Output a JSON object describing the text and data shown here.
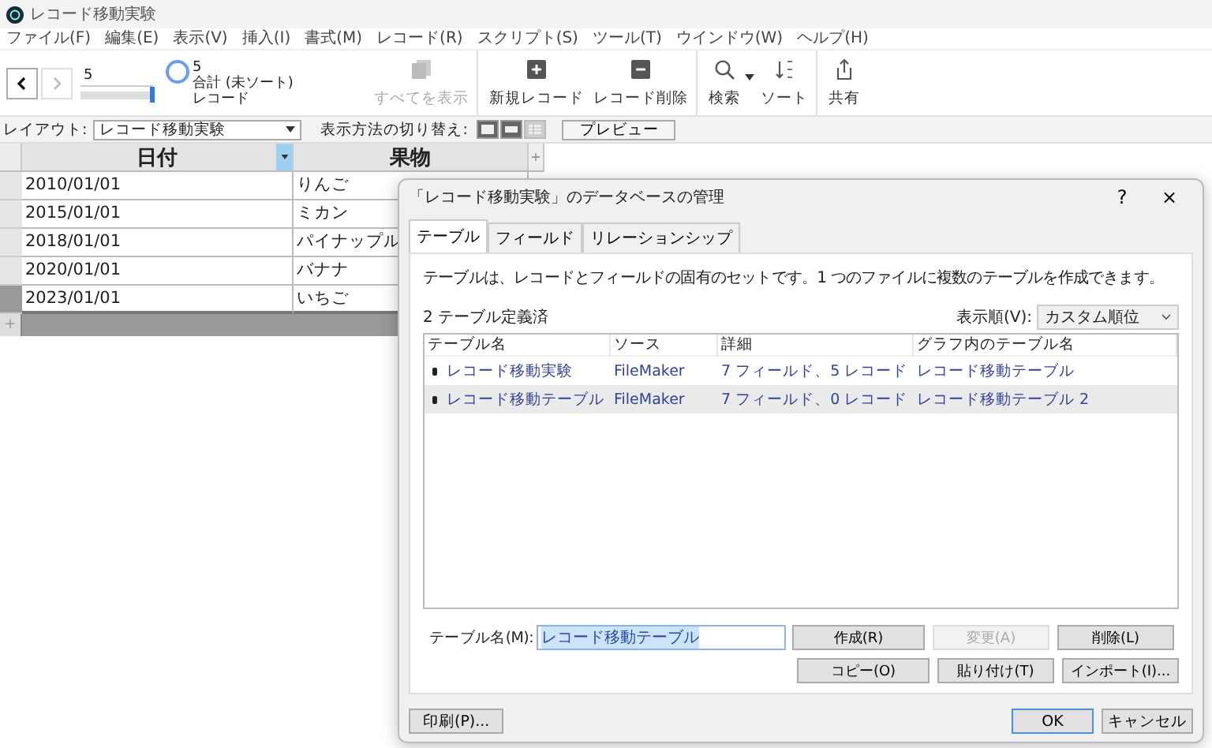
{
  "window": {
    "title": "レコード移動実験"
  },
  "menu": [
    "ファイル(F)",
    "編集(E)",
    "表示(V)",
    "挿入(I)",
    "書式(M)",
    "レコード(R)",
    "スクリプト(S)",
    "ツール(T)",
    "ウインドウ(W)",
    "ヘルプ(H)"
  ],
  "toolbar": {
    "record_field": "5",
    "record_slider": {
      "level": 1
    },
    "record_count": "5",
    "record_status": "合計 (未ソート)",
    "record_unit": "レコード",
    "groups": [
      [
        {
          "kind": "show-all",
          "label": "すべてを表示",
          "disabled": true
        }
      ],
      [
        {
          "kind": "new",
          "label": "新規レコード",
          "disabled": false
        },
        {
          "kind": "delete",
          "label": "レコード削除",
          "disabled": false
        }
      ],
      [
        {
          "kind": "search",
          "label": "検索",
          "disabled": false
        },
        {
          "kind": "sort",
          "label": "ソート",
          "disabled": false
        }
      ],
      [
        {
          "kind": "share",
          "label": "共有",
          "disabled": false
        }
      ]
    ]
  },
  "layout_bar": {
    "layout_label": "レイアウト:",
    "layout_value": "レコード移動実験",
    "view_label": "表示方法の切り替え:",
    "view_modes": [
      {
        "kind": "form",
        "selected": false
      },
      {
        "kind": "list",
        "selected": false
      },
      {
        "kind": "table",
        "selected": true
      }
    ],
    "preview_button": "プレビュー"
  },
  "table": {
    "columns": [
      {
        "label": "日付",
        "selected": true
      },
      {
        "label": "果物",
        "selected": false
      }
    ],
    "rows": [
      {
        "cells": [
          "2010/01/01",
          "りんご"
        ],
        "selected": false
      },
      {
        "cells": [
          "2015/01/01",
          "ミカン"
        ],
        "selected": false
      },
      {
        "cells": [
          "2018/01/01",
          "パイナップル"
        ],
        "selected": false
      },
      {
        "cells": [
          "2020/01/01",
          "バナナ"
        ],
        "selected": false
      },
      {
        "cells": [
          "2023/01/01",
          "いちご"
        ],
        "selected": true
      }
    ],
    "add_row": "+",
    "add_column": "+"
  },
  "dialog": {
    "title": "「レコード移動実験」のデータベースの管理",
    "help": "?",
    "close": "×",
    "tabs": [
      {
        "label": "テーブル",
        "selected": true
      },
      {
        "label": "フィールド",
        "selected": false
      },
      {
        "label": "リレーションシップ",
        "selected": false
      }
    ],
    "description": "テーブルは、レコードとフィールドの固有のセットです。1 つのファイルに複数のテーブルを作成できます。",
    "count_label": "2 テーブル定義済",
    "sort_label": "表示順(V):",
    "sort_value": "カスタム順位",
    "list_columns": [
      "テーブル名",
      "ソース",
      "詳細",
      "グラフ内のテーブル名"
    ],
    "list_rows": [
      {
        "cells": [
          "レコード移動実験",
          "FileMaker",
          "7 フィールド、5 レコード",
          "レコード移動テーブル"
        ],
        "selected": false
      },
      {
        "cells": [
          "レコード移動テーブル",
          "FileMaker",
          "7 フィールド、0 レコード",
          "レコード移動テーブル 2"
        ],
        "selected": true
      }
    ],
    "name_label": "テーブル名(M):",
    "name_value": "レコード移動テーブル",
    "button_rows": [
      [
        {
          "label": "作成(R)",
          "disabled": false
        },
        {
          "label": "変更(A)",
          "disabled": true
        },
        {
          "label": "削除(L)",
          "disabled": false
        }
      ],
      [
        {
          "label": "コピー(O)",
          "disabled": false
        },
        {
          "label": "貼り付け(T)",
          "disabled": false
        },
        {
          "label": "インポート(I)...",
          "disabled": false
        }
      ]
    ],
    "print_button": "印刷(P)...",
    "ok_button": "OK",
    "cancel_button": "キャンセル"
  }
}
